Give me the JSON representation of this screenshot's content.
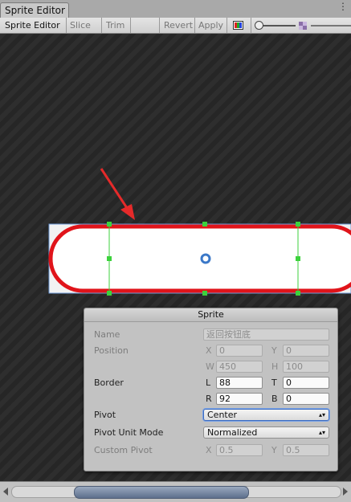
{
  "window": {
    "tab_title": "Sprite Editor"
  },
  "toolbar": {
    "mode_label": "Sprite Editor",
    "slice_label": "Slice",
    "trim_label": "Trim",
    "revert_label": "Revert",
    "apply_label": "Apply",
    "color_channel_icon": "rgb-channel-icon",
    "zoom_icon": "mip-level-icon"
  },
  "sprite_panel": {
    "title": "Sprite",
    "name_label": "Name",
    "name_value": "返回按钮底",
    "position_label": "Position",
    "x_label": "X",
    "x_value": "0",
    "y_label": "Y",
    "y_value": "0",
    "w_label": "W",
    "w_value": "450",
    "h_label": "H",
    "h_value": "100",
    "border_label": "Border",
    "l_label": "L",
    "l_value": "88",
    "t_label": "T",
    "t_value": "0",
    "r_label": "R",
    "r_value": "92",
    "b_label": "B",
    "b_value": "0",
    "pivot_label": "Pivot",
    "pivot_value": "Center",
    "pivot_unit_label": "Pivot Unit Mode",
    "pivot_unit_value": "Normalized",
    "custom_pivot_label": "Custom Pivot",
    "cx_label": "X",
    "cx_value": "0.5",
    "cy_label": "Y",
    "cy_value": "0.5"
  },
  "colors": {
    "sprite_outline": "#e0141a",
    "border_guides": "#3cd23c",
    "annotation_arrow": "#e62a2a",
    "selection_rect": "#6f9ad8"
  }
}
